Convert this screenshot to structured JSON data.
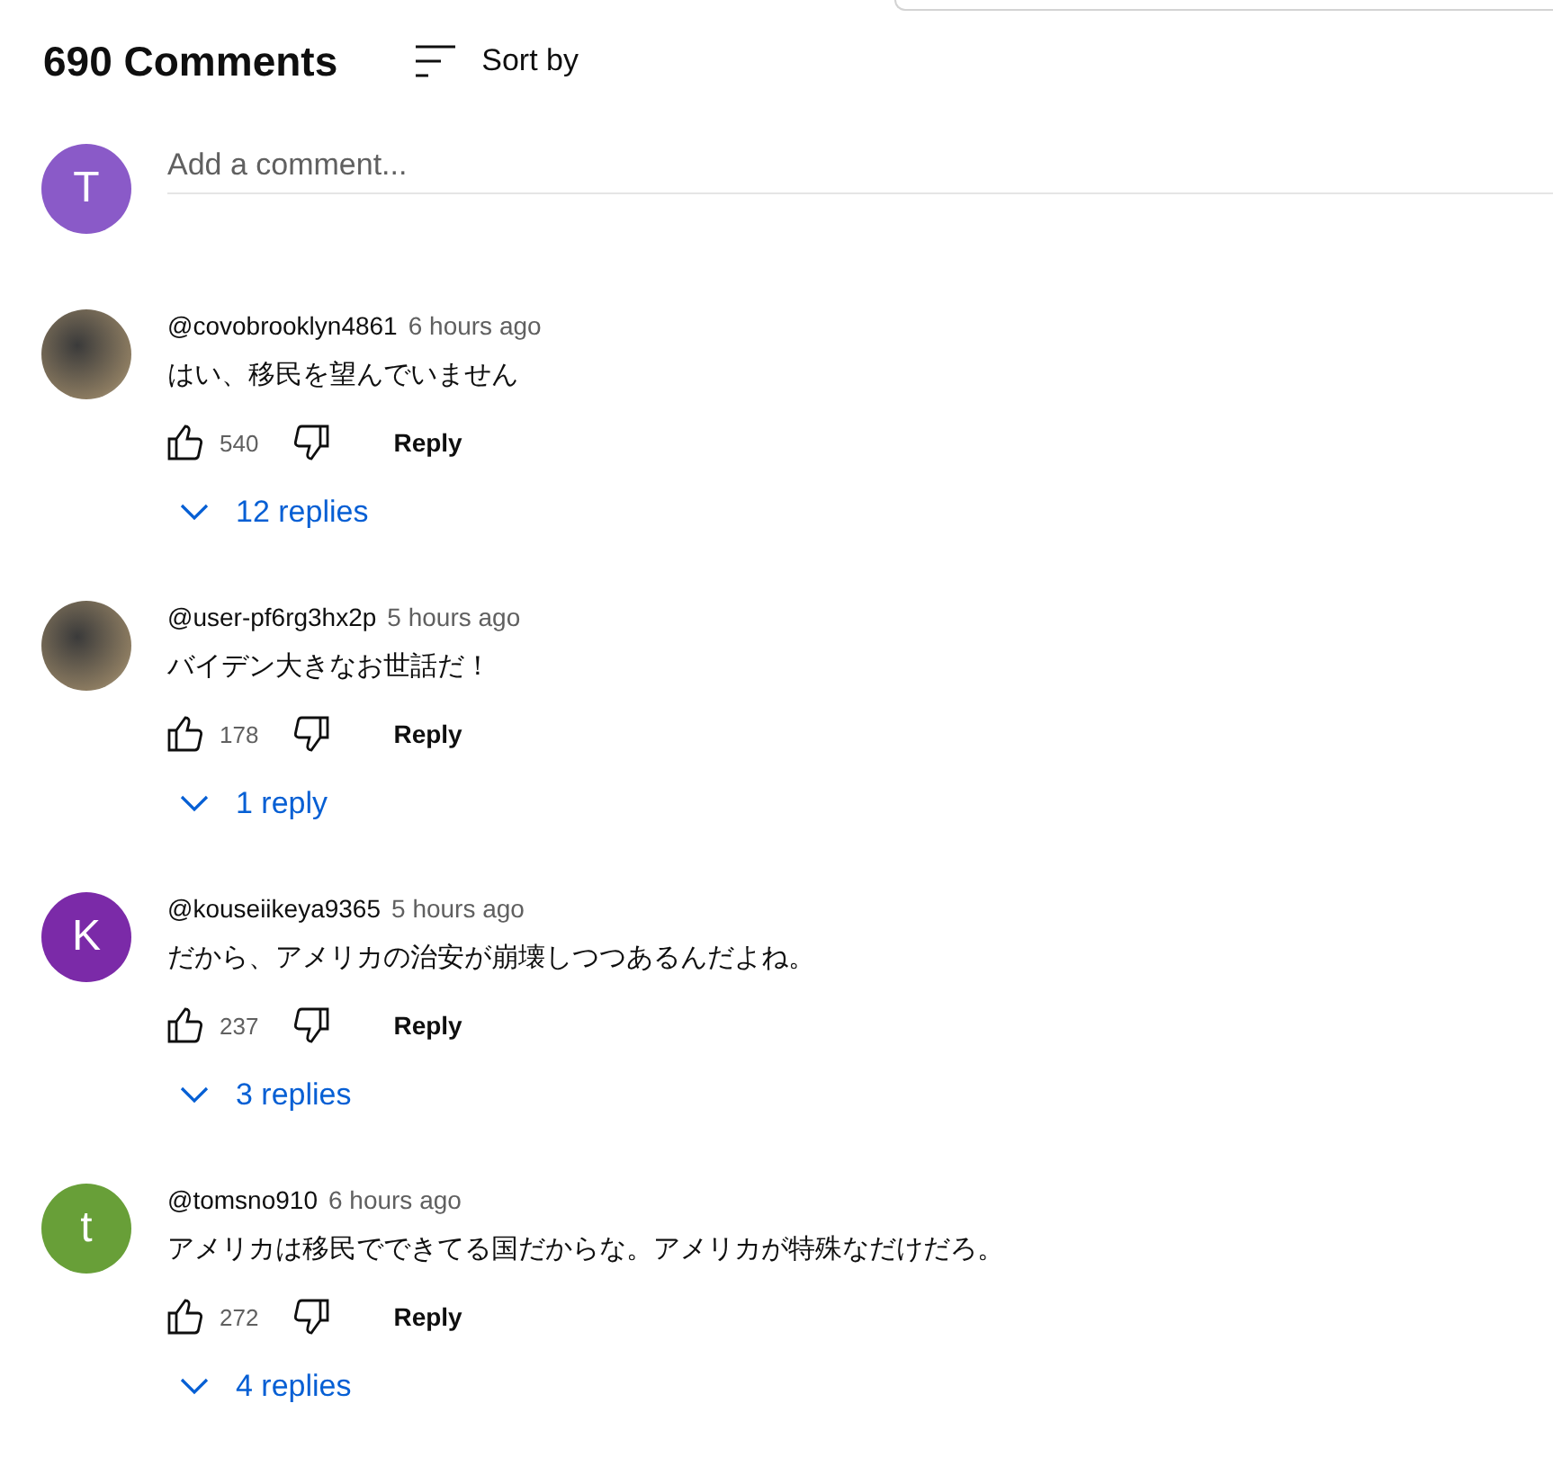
{
  "header": {
    "count": "690 Comments",
    "sort_label": "Sort by"
  },
  "add_comment": {
    "avatar": {
      "letter": "T",
      "color": "#8a5ac8"
    },
    "placeholder": "Add a comment..."
  },
  "comments": [
    {
      "avatar": {
        "kind": "photo"
      },
      "author": "@covobrooklyn4861",
      "time": "6 hours ago",
      "text": "はい、移民を望んでいません",
      "likes": "540",
      "reply_label": "Reply",
      "replies": "12 replies"
    },
    {
      "avatar": {
        "kind": "photo"
      },
      "author": "@user-pf6rg3hx2p",
      "time": "5 hours ago",
      "text": "バイデン大きなお世話だ！",
      "likes": "178",
      "reply_label": "Reply",
      "replies": "1 reply"
    },
    {
      "avatar": {
        "kind": "letter",
        "letter": "K",
        "color": "#7b2aa8"
      },
      "author": "@kouseiikeya9365",
      "time": "5 hours ago",
      "text": "だから、アメリカの治安が崩壊しつつあるんだよね。",
      "likes": "237",
      "reply_label": "Reply",
      "replies": "3 replies"
    },
    {
      "avatar": {
        "kind": "letter",
        "letter": "t",
        "color": "#689f38"
      },
      "author": "@tomsno910",
      "time": "6 hours ago",
      "text": "アメリカは移民でできてる国だからな。アメリカが特殊なだけだろ。",
      "likes": "272",
      "reply_label": "Reply",
      "replies": "4 replies"
    }
  ]
}
